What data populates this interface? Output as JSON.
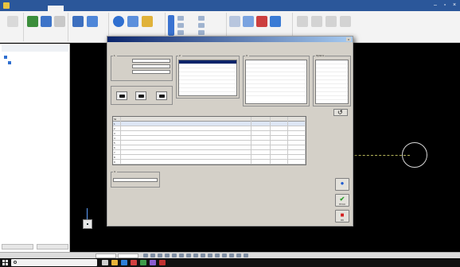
{
  "window": {
    "title": "",
    "tabs": [
      "",
      "",
      "",
      "",
      "",
      ""
    ],
    "active_tab_index": 2
  },
  "ribbon": {
    "group_labels": [
      "",
      "",
      "",
      "",
      "",
      "",
      ""
    ]
  },
  "left_panel": {
    "tree": [
      "",
      ""
    ],
    "foot_buttons": [
      "",
      ""
    ]
  },
  "dialog": {
    "title": "",
    "info_line": "",
    "section1": {
      "title": "1.",
      "rows": [
        {
          "label": "",
          "value": ""
        },
        {
          "label": "",
          "value": ""
        },
        {
          "label": "",
          "value": ""
        }
      ]
    },
    "tools_frame": {
      "title": ""
    },
    "section2": {
      "title": "2.",
      "header": "",
      "items": [
        "",
        "",
        "",
        "",
        "",
        "",
        ""
      ]
    },
    "section3": {
      "title": "3.",
      "rows": [
        {
          "label": "",
          "value": ""
        },
        {
          "label": "",
          "value": ""
        },
        {
          "label": "",
          "value": ""
        },
        {
          "label": "",
          "value": ""
        },
        {
          "label": "",
          "value": ""
        },
        {
          "label": "",
          "value": ""
        },
        {
          "label": "",
          "value": ""
        },
        {
          "label": "",
          "value": ""
        },
        {
          "label": "",
          "value": ""
        }
      ]
    },
    "options": {
      "title": "Options",
      "rows": [
        "",
        "",
        "",
        "",
        "",
        "",
        "",
        "",
        "",
        ""
      ]
    },
    "table_section": {
      "title": "",
      "count_text": ""
    },
    "table": {
      "columns": [
        "№",
        "",
        "",
        "",
        ""
      ],
      "rows": [
        [
          "1",
          "",
          "",
          "",
          ""
        ],
        [
          "2",
          "",
          "",
          "",
          ""
        ],
        [
          "3",
          "",
          "",
          "",
          ""
        ],
        [
          "4",
          "",
          "",
          "",
          ""
        ],
        [
          "5",
          "",
          "",
          "",
          ""
        ],
        [
          "6",
          "",
          "",
          "",
          ""
        ],
        [
          "7",
          "",
          "",
          "",
          ""
        ],
        [
          "8",
          "",
          "",
          "",
          ""
        ],
        [
          "9",
          "",
          "",
          "",
          ""
        ]
      ]
    },
    "section4": {
      "title": "4.",
      "value": ""
    },
    "buttons": {
      "start": "ПУСК",
      "ok": "OK"
    }
  },
  "taskbar": {
    "search_placeholder": "",
    "time": "",
    "date": ""
  },
  "colors": {
    "title_bar": "#2b579a",
    "canvas": "#000000",
    "dialog_face": "#d4d0c8",
    "ok_green": "#2e9e2e",
    "close_red": "#d42020",
    "info_blue": "#1e5bd0"
  }
}
